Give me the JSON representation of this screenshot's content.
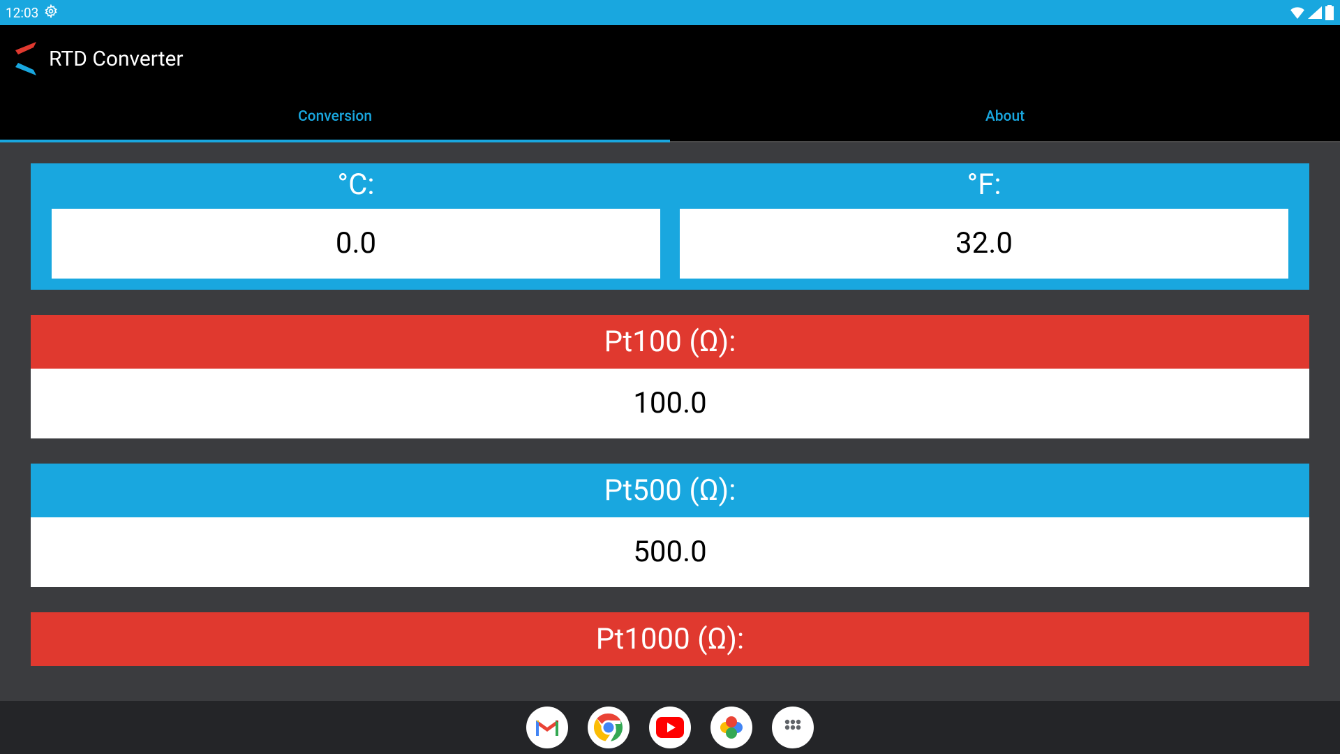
{
  "status": {
    "time": "12:03"
  },
  "app": {
    "title": "RTD Converter"
  },
  "tabs": {
    "conversion": "Conversion",
    "about": "About"
  },
  "temperature": {
    "c_label": "°C:",
    "f_label": "°F:",
    "c_value": "0.0",
    "f_value": "32.0"
  },
  "cards": {
    "pt100": {
      "label": "Pt100 (Ω):",
      "value": "100.0"
    },
    "pt500": {
      "label": "Pt500 (Ω):",
      "value": "500.0"
    },
    "pt1000": {
      "label": "Pt1000 (Ω):"
    }
  },
  "dock_icons": [
    "gmail",
    "chrome",
    "youtube",
    "photos",
    "apps"
  ]
}
